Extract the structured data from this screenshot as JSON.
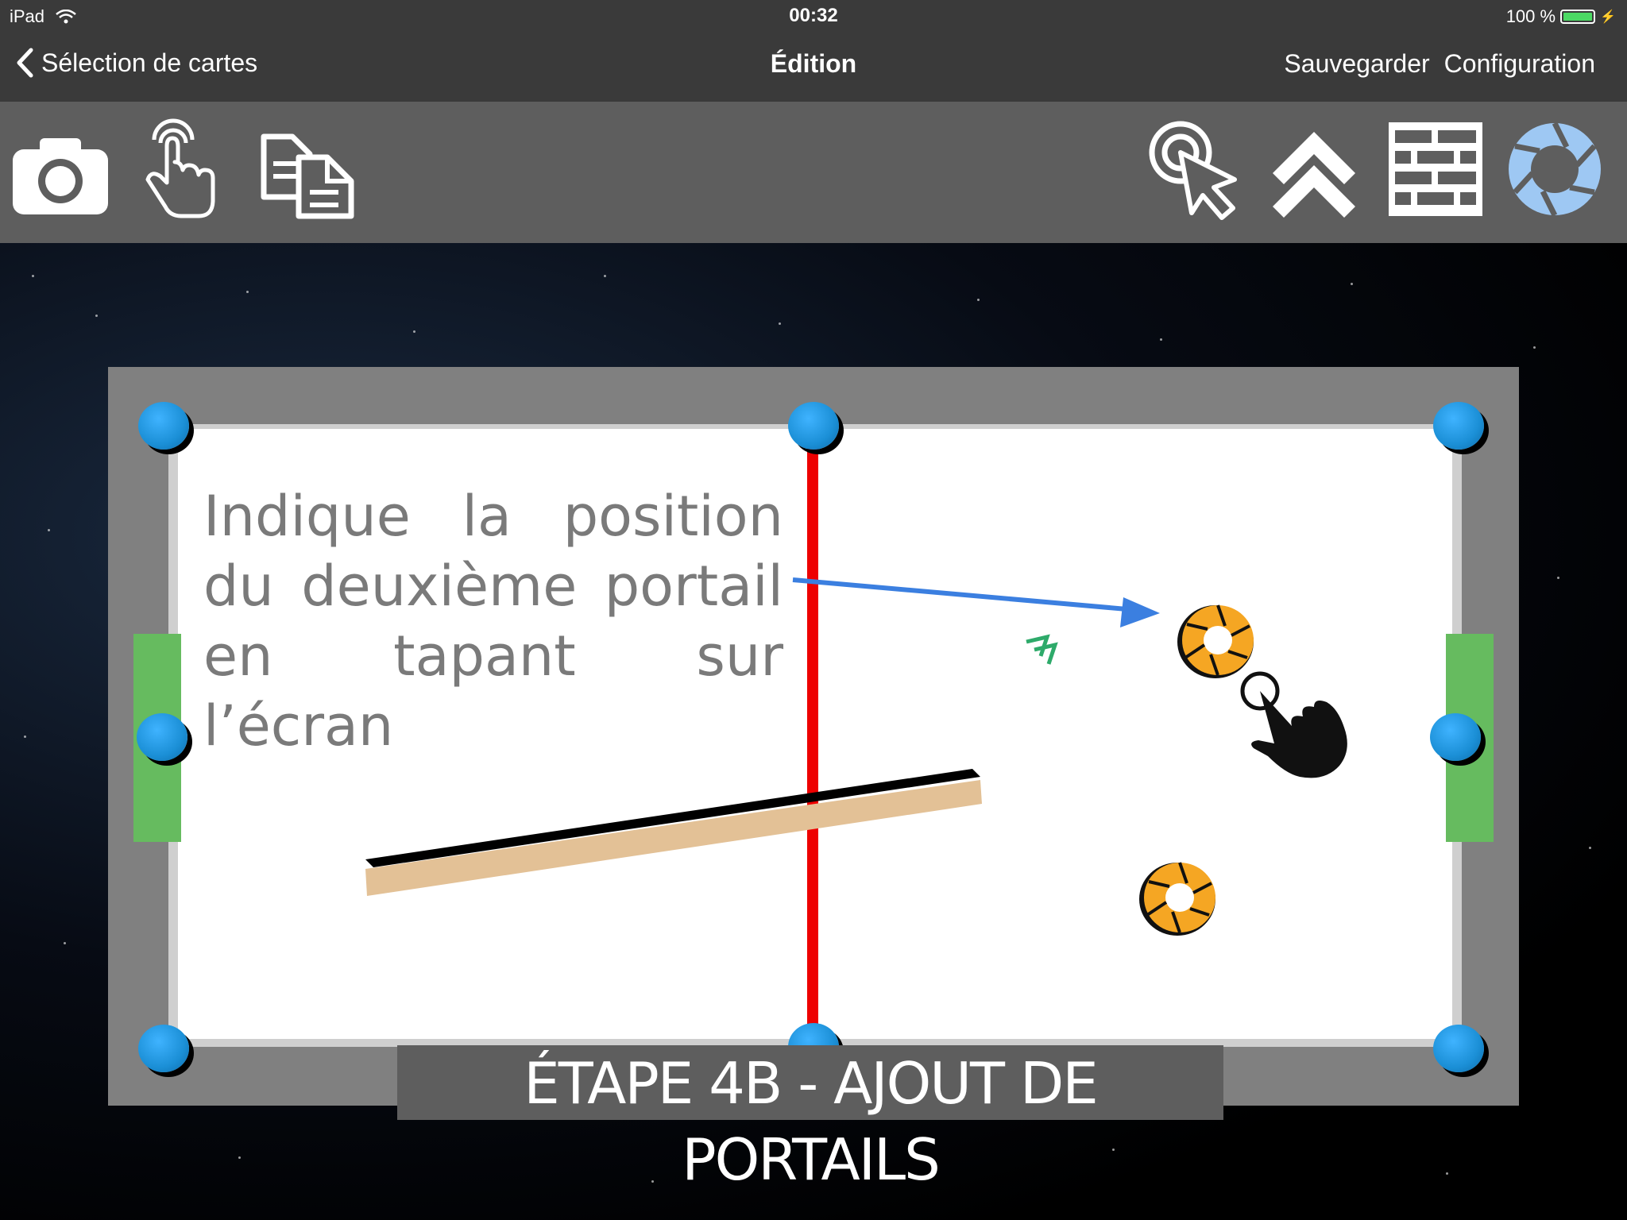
{
  "status_bar": {
    "device": "iPad",
    "time": "00:32",
    "battery": "100 %"
  },
  "nav": {
    "back_label": "Sélection de cartes",
    "title": "Édition",
    "save_label": "Sauvegarder",
    "config_label": "Configuration"
  },
  "toolbar": {
    "left_tools": [
      "camera-icon",
      "tap-hand-icon",
      "copy-documents-icon"
    ],
    "right_tools": [
      "target-cursor-icon",
      "double-chevron-up-icon",
      "brick-wall-icon",
      "portal-aperture-icon"
    ],
    "active_tool": "portal-aperture-icon"
  },
  "board": {
    "instruction_lines": [
      "Indique la position",
      "du deuxième portail",
      "en tapant sur l’écran"
    ],
    "step_label": "ÉTAPE 4B - AJOUT DE PORTAILS"
  },
  "colors": {
    "accent_blue": "#3b7fe0",
    "goal_green": "#66bb5f",
    "center_line_red": "#ee0000",
    "portal_orange": "#f5a623",
    "ball_blue": "#1b8fd6",
    "plank_tan": "#e3c196"
  }
}
